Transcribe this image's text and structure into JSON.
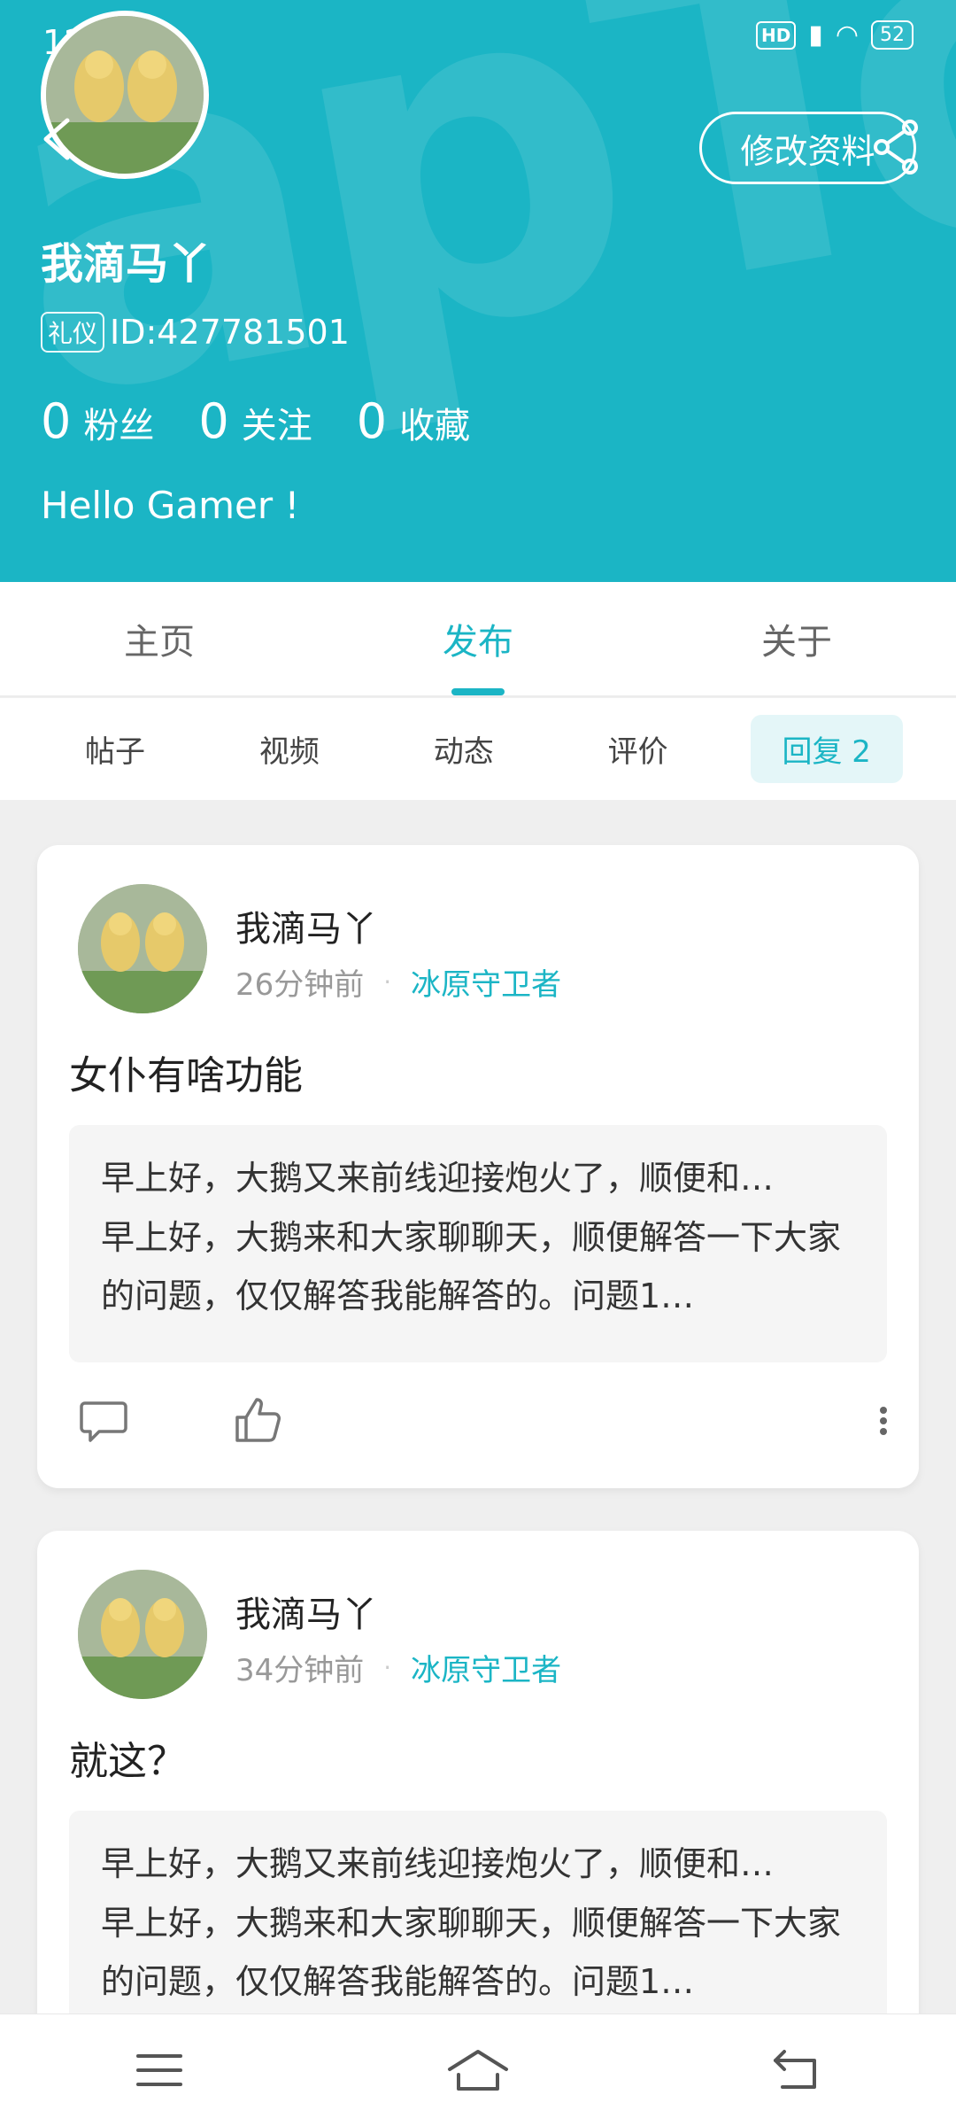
{
  "status_bar": {
    "time": "12:47",
    "hd_label": "HD",
    "battery": "52"
  },
  "profile": {
    "edit_label": "修改资料",
    "username": "我滴马丫",
    "badge": "礼仪",
    "id_text": "ID:427781501",
    "stats": [
      {
        "num": "0",
        "label": "粉丝"
      },
      {
        "num": "0",
        "label": "关注"
      },
      {
        "num": "0",
        "label": "收藏"
      }
    ],
    "bio": "Hello Gamer !"
  },
  "main_tabs": [
    {
      "label": "主页",
      "active": false
    },
    {
      "label": "发布",
      "active": true
    },
    {
      "label": "关于",
      "active": false
    }
  ],
  "sub_tabs": [
    {
      "label": "帖子",
      "active": false
    },
    {
      "label": "视频",
      "active": false
    },
    {
      "label": "动态",
      "active": false
    },
    {
      "label": "评价",
      "active": false
    },
    {
      "label": "回复 2",
      "active": true
    }
  ],
  "posts": [
    {
      "author": "我滴马丫",
      "time": "26分钟前",
      "separator": "·",
      "game": "冰原守卫者",
      "title": "女仆有啥功能",
      "quote_line1": "早上好，大鹅又来前线迎接炮火了，顺便和…",
      "quote_line2": "早上好，大鹅来和大家聊聊天，顺便解答一下大家的问题，仅仅解答我能解答的。问题1…"
    },
    {
      "author": "我滴马丫",
      "time": "34分钟前",
      "separator": "·",
      "game": "冰原守卫者",
      "title": "就这？",
      "quote_line1": "早上好，大鹅又来前线迎接炮火了，顺便和…",
      "quote_line2": "早上好，大鹅来和大家聊聊天，顺便解答一下大家的问题，仅仅解答我能解答的。问题1…"
    }
  ],
  "colors": {
    "accent": "#1bb5c5",
    "background": "#efefef"
  }
}
